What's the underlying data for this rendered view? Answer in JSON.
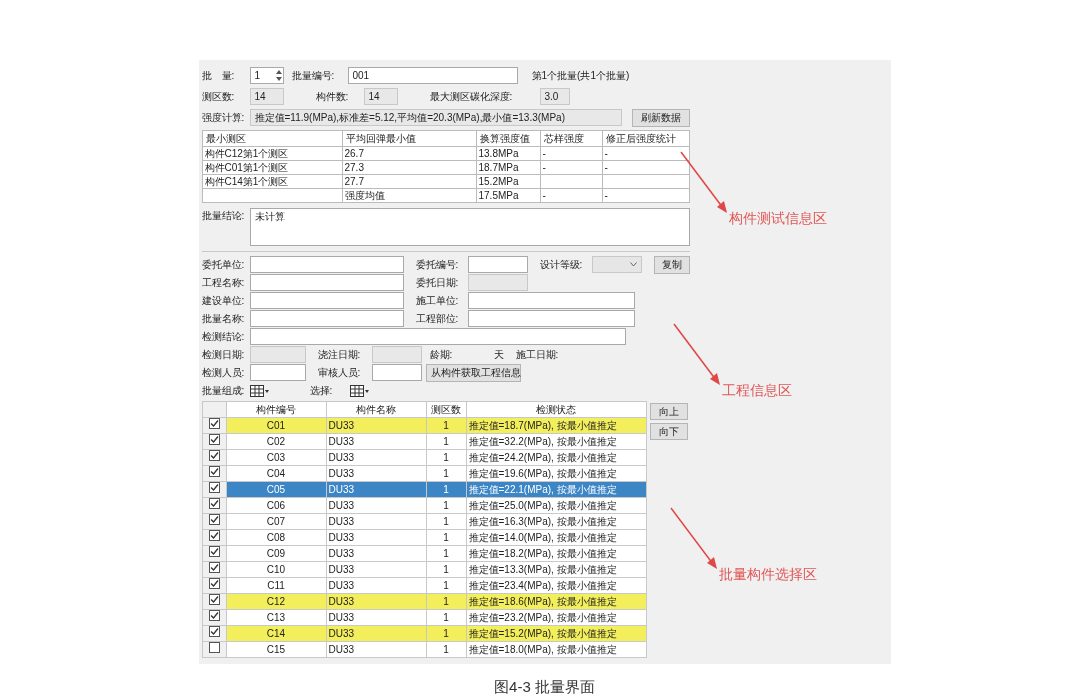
{
  "batch_header": {
    "position_text": "第1个批量(共1个批量)",
    "rows": [
      [
        {
          "kind": "label",
          "text": "批　量:"
        },
        {
          "kind": "spinner",
          "value": "1"
        },
        {
          "kind": "label",
          "text": "批量编号:"
        },
        {
          "kind": "input",
          "value": "001"
        }
      ],
      [
        {
          "kind": "label",
          "text": "测区数:"
        },
        {
          "kind": "readonly",
          "value": "14"
        },
        {
          "kind": "label",
          "text": "构件数:"
        },
        {
          "kind": "readonly",
          "value": "14"
        },
        {
          "kind": "label",
          "text": "最大测区碳化深度:"
        },
        {
          "kind": "readonly",
          "value": "3.0"
        }
      ],
      [
        {
          "kind": "label",
          "text": "强度计算:"
        },
        {
          "kind": "readonly",
          "value": "推定值=11.9(MPa),标准差=5.12,平均值=20.3(MPa),最小值=13.3(MPa)"
        },
        {
          "kind": "button",
          "text": "刷新数据"
        }
      ]
    ]
  },
  "summary_table": {
    "columns": [
      "最小测区",
      "平均回弹最小值",
      "换算强度值",
      "芯样强度",
      "修正后强度统计"
    ],
    "rows": [
      [
        "构件C12第1个测区",
        "26.7",
        "13.8MPa",
        "-",
        "-"
      ],
      [
        "构件C01第1个测区",
        "27.3",
        "18.7MPa",
        "-",
        "-"
      ],
      [
        "构件C14第1个测区",
        "27.7",
        "15.2MPa",
        "",
        ""
      ],
      [
        "",
        "强度均值",
        "17.5MPa",
        "-",
        "-"
      ]
    ]
  },
  "conclusion": {
    "label": "批量结论:",
    "value": "未计算"
  },
  "project_info": {
    "rows": [
      [
        {
          "kind": "label",
          "text": "委托单位:"
        },
        {
          "kind": "input"
        },
        {
          "kind": "label",
          "text": "委托编号:"
        },
        {
          "kind": "input"
        },
        {
          "kind": "label",
          "text": "设计等级:"
        },
        {
          "kind": "select"
        },
        {
          "kind": "button",
          "text": "复制"
        }
      ],
      [
        {
          "kind": "label",
          "text": "工程名称:"
        },
        {
          "kind": "input"
        },
        {
          "kind": "label",
          "text": "委托日期:"
        },
        {
          "kind": "readonly"
        }
      ],
      [
        {
          "kind": "label",
          "text": "建设单位:"
        },
        {
          "kind": "input"
        },
        {
          "kind": "label",
          "text": "施工单位:"
        },
        {
          "kind": "input"
        }
      ],
      [
        {
          "kind": "label",
          "text": "批量名称:"
        },
        {
          "kind": "input"
        },
        {
          "kind": "label",
          "text": "工程部位:"
        },
        {
          "kind": "input"
        }
      ],
      [
        {
          "kind": "label",
          "text": "检测结论:"
        },
        {
          "kind": "input"
        }
      ],
      [
        {
          "kind": "label",
          "text": "检测日期:"
        },
        {
          "kind": "readonly"
        },
        {
          "kind": "label",
          "text": "浇注日期:"
        },
        {
          "kind": "readonly"
        },
        {
          "kind": "label",
          "text": "龄期:"
        },
        {
          "kind": "text",
          "text": "天"
        },
        {
          "kind": "label",
          "text": "施工日期:"
        }
      ],
      [
        {
          "kind": "label",
          "text": "检测人员:"
        },
        {
          "kind": "input"
        },
        {
          "kind": "label",
          "text": "审核人员:"
        },
        {
          "kind": "input"
        },
        {
          "kind": "button",
          "text": "从构件获取工程信息"
        }
      ],
      [
        {
          "kind": "label",
          "text": "批量组成:"
        },
        {
          "kind": "icon_select"
        },
        {
          "kind": "label",
          "text": "选择:"
        },
        {
          "kind": "icon_select"
        }
      ]
    ]
  },
  "components": {
    "columns": [
      "构件编号",
      "构件名称",
      "测区数",
      "检测状态"
    ],
    "rows": [
      {
        "checked": true,
        "selected": false,
        "highlighted": true,
        "cells": [
          "C01",
          "DU33",
          "1",
          "推定值=18.7(MPa), 按最小值推定"
        ]
      },
      {
        "checked": true,
        "selected": false,
        "highlighted": false,
        "cells": [
          "C02",
          "DU33",
          "1",
          "推定值=32.2(MPa), 按最小值推定"
        ]
      },
      {
        "checked": true,
        "selected": false,
        "highlighted": false,
        "cells": [
          "C03",
          "DU33",
          "1",
          "推定值=24.2(MPa), 按最小值推定"
        ]
      },
      {
        "checked": true,
        "selected": false,
        "highlighted": false,
        "cells": [
          "C04",
          "DU33",
          "1",
          "推定值=19.6(MPa), 按最小值推定"
        ]
      },
      {
        "checked": true,
        "selected": true,
        "highlighted": false,
        "cells": [
          "C05",
          "DU33",
          "1",
          "推定值=22.1(MPa), 按最小值推定"
        ]
      },
      {
        "checked": true,
        "selected": false,
        "highlighted": false,
        "cells": [
          "C06",
          "DU33",
          "1",
          "推定值=25.0(MPa), 按最小值推定"
        ]
      },
      {
        "checked": true,
        "selected": false,
        "highlighted": false,
        "cells": [
          "C07",
          "DU33",
          "1",
          "推定值=16.3(MPa), 按最小值推定"
        ]
      },
      {
        "checked": true,
        "selected": false,
        "highlighted": false,
        "cells": [
          "C08",
          "DU33",
          "1",
          "推定值=14.0(MPa), 按最小值推定"
        ]
      },
      {
        "checked": true,
        "selected": false,
        "highlighted": false,
        "cells": [
          "C09",
          "DU33",
          "1",
          "推定值=18.2(MPa), 按最小值推定"
        ]
      },
      {
        "checked": true,
        "selected": false,
        "highlighted": false,
        "cells": [
          "C10",
          "DU33",
          "1",
          "推定值=13.3(MPa), 按最小值推定"
        ]
      },
      {
        "checked": true,
        "selected": false,
        "highlighted": false,
        "cells": [
          "C11",
          "DU33",
          "1",
          "推定值=23.4(MPa), 按最小值推定"
        ]
      },
      {
        "checked": true,
        "selected": false,
        "highlighted": true,
        "cells": [
          "C12",
          "DU33",
          "1",
          "推定值=18.6(MPa), 按最小值推定"
        ]
      },
      {
        "checked": true,
        "selected": false,
        "highlighted": false,
        "cells": [
          "C13",
          "DU33",
          "1",
          "推定值=23.2(MPa), 按最小值推定"
        ]
      },
      {
        "checked": true,
        "selected": false,
        "highlighted": true,
        "cells": [
          "C14",
          "DU33",
          "1",
          "推定值=15.2(MPa), 按最小值推定"
        ]
      },
      {
        "checked": false,
        "selected": false,
        "highlighted": false,
        "cells": [
          "C15",
          "DU33",
          "1",
          "推定值=18.0(MPa), 按最小值推定"
        ]
      }
    ]
  },
  "side_buttons": [
    "向上",
    "向下"
  ],
  "annotations": [
    "构件测试信息区",
    "工程信息区",
    "批量构件选择区"
  ],
  "figure": {
    "caption": "图4-3 批量界面"
  }
}
